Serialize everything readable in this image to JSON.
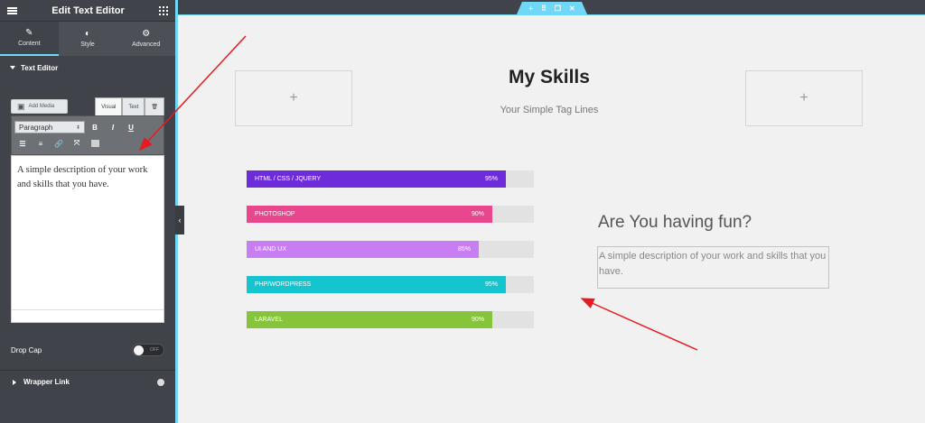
{
  "sidebar": {
    "title": "Edit Text Editor",
    "tabs": [
      {
        "label": "Content",
        "icon": "pencil-icon"
      },
      {
        "label": "Style",
        "icon": "half-circle-icon"
      },
      {
        "label": "Advanced",
        "icon": "gear-icon"
      }
    ],
    "section_title": "Text Editor",
    "add_media_label": "Add Media",
    "mode_tabs": [
      "Visual",
      "Text"
    ],
    "format_select": "Paragraph",
    "editor_content": "A simple description of your work and skills that you have.",
    "drop_cap_label": "Drop Cap",
    "drop_cap_state": "OFF",
    "wrapper_link_label": "Wrapper Link"
  },
  "canvas": {
    "heading": "My Skills",
    "subheading": "Your Simple Tag Lines",
    "skills": [
      {
        "label": "HTML / CSS / JQUERY",
        "value": "95%",
        "fraction": 0.95,
        "color": "#6d2bd9"
      },
      {
        "label": "PHOTOSHOP",
        "value": "90%",
        "fraction": 0.9,
        "color": "#e8468d"
      },
      {
        "label": "UI AND UX",
        "value": "85%",
        "fraction": 0.85,
        "color": "#c77ef2"
      },
      {
        "label": "PHP/WORDPRESS",
        "value": "95%",
        "fraction": 0.95,
        "color": "#14c4cf"
      },
      {
        "label": "LARAVEL",
        "value": "90%",
        "fraction": 0.9,
        "color": "#86c43c"
      }
    ],
    "fun_title": "Are You having fun?",
    "fun_description": "A simple description of your work and skills that you have."
  },
  "colors": {
    "accent": "#71d7f7",
    "panel": "#404349",
    "arrow": "#e8191f"
  }
}
